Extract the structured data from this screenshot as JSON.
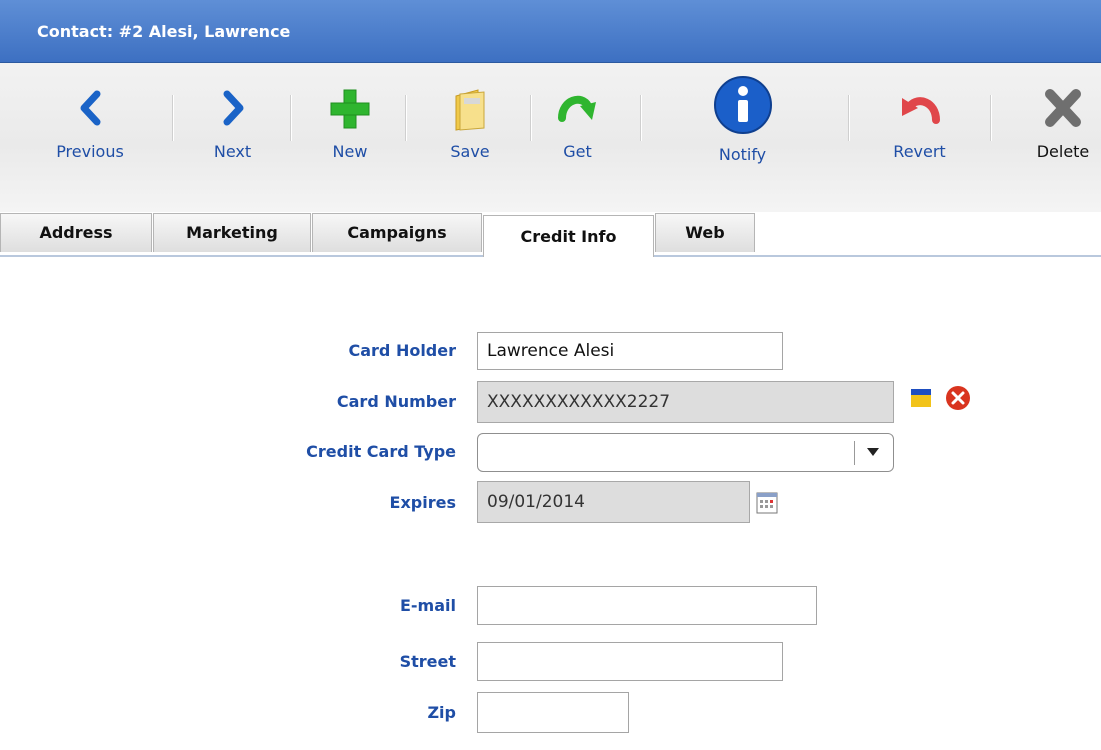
{
  "window": {
    "title": "Contact: #2  Alesi, Lawrence"
  },
  "toolbar": {
    "previous": "Previous",
    "next": "Next",
    "new": "New",
    "save": "Save",
    "get": "Get",
    "notify": "Notify",
    "revert": "Revert",
    "delete": "Delete"
  },
  "tabs": [
    "Address",
    "Marketing",
    "Campaigns",
    "Credit Info",
    "Web"
  ],
  "active_tab": "Credit Info",
  "form": {
    "card_holder": {
      "label": "Card Holder",
      "value": "Lawrence Alesi"
    },
    "card_number": {
      "label": "Card Number",
      "value": "XXXXXXXXXXXX2227"
    },
    "card_type": {
      "label": "Credit Card Type",
      "value": ""
    },
    "expires": {
      "label": "Expires",
      "value": "09/01/2014"
    },
    "email": {
      "label": "E-mail",
      "value": ""
    },
    "street": {
      "label": "Street",
      "value": ""
    },
    "zip": {
      "label": "Zip",
      "value": ""
    }
  },
  "icons": {
    "previous": "chevron-left-icon",
    "next": "chevron-right-icon",
    "new": "plus-icon",
    "save": "folder-save-icon",
    "get": "refresh-arrow-icon",
    "notify": "info-icon",
    "revert": "undo-arrow-icon",
    "delete": "x-delete-icon",
    "card_edit": "card-edit-icon",
    "card_clear": "clear-icon",
    "calendar": "calendar-icon"
  },
  "colors": {
    "title_bar": "#4a7cc9",
    "label_blue": "#1f4ea6",
    "plus_green": "#2fb52f",
    "info_blue": "#1b5fc9",
    "revert_red": "#e0464a",
    "delete_gray": "#777777",
    "clear_red": "#d9341f"
  }
}
